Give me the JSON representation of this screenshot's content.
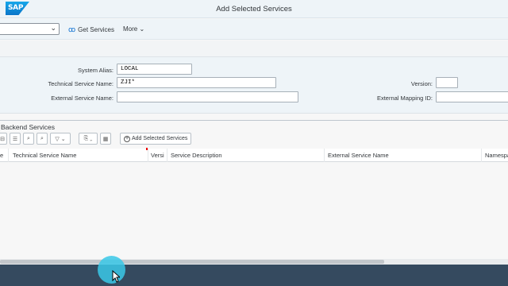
{
  "titlebar": {
    "logo_text": "SAP",
    "title": "Add Selected Services"
  },
  "toolbar": {
    "select_value": "",
    "get_services_label": "Get Services",
    "more_label": "More"
  },
  "form": {
    "system_alias": {
      "label": "System Alias:",
      "value": "LOCAL"
    },
    "technical_service_name": {
      "label": "Technical Service Name:",
      "value": "ZJI*"
    },
    "external_service_name": {
      "label": "External Service Name:",
      "value": ""
    },
    "version": {
      "label": "Version:",
      "value": ""
    },
    "external_mapping_id": {
      "label": "External Mapping ID:",
      "value": ""
    }
  },
  "panel": {
    "title": "Backend Services",
    "add_selected_label": "Add Selected Services"
  },
  "table": {
    "columns": [
      "e",
      "Technical Service Name",
      "Versi",
      "Service Description",
      "External Service Name",
      "Namespa"
    ]
  },
  "colors": {
    "accent": "#0a6ed1",
    "statusbar": "#354a5f",
    "cursor_halo": "#3ac8e8"
  }
}
